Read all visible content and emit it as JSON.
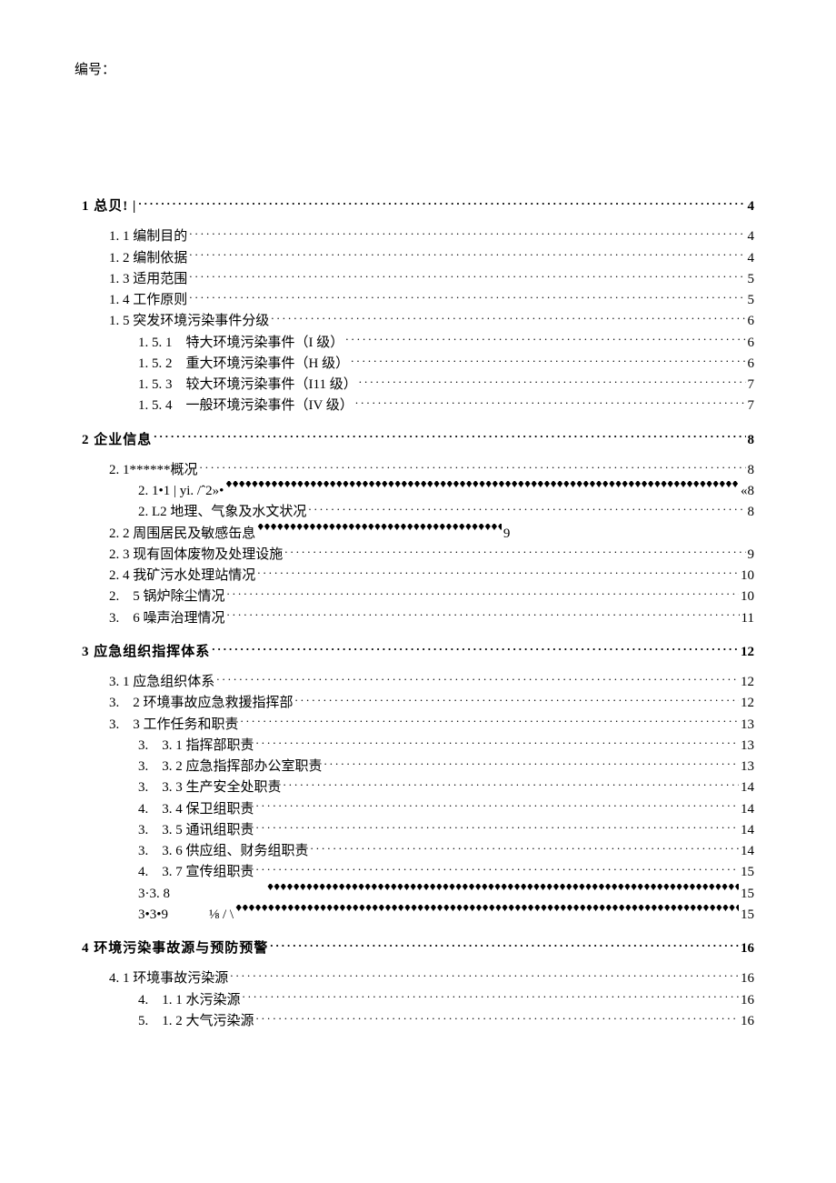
{
  "header": {
    "label": "编号："
  },
  "toc": [
    {
      "heading": {
        "text": "1 总贝! |",
        "page": "4"
      },
      "items": [
        {
          "indent": 1,
          "text": "1. 1 编制目的",
          "page": "4",
          "leader": "dot"
        },
        {
          "indent": 1,
          "text": "1. 2 编制依据",
          "page": "4",
          "leader": "dot"
        },
        {
          "indent": 1,
          "text": "1. 3 适用范围",
          "page": "5",
          "leader": "dot"
        },
        {
          "indent": 1,
          "text": "1. 4 工作原则",
          "page": "5",
          "leader": "dot"
        },
        {
          "indent": 1,
          "text": "1. 5 突发环境污染事件分级",
          "page": "6",
          "leader": "dot"
        },
        {
          "indent": 2,
          "text": "1. 5. 1　特大环境污染事件（I 级）",
          "page": "6",
          "leader": "dot"
        },
        {
          "indent": 2,
          "text": "1. 5. 2　重大环境污染事件（H 级）",
          "page": "6",
          "leader": "dot"
        },
        {
          "indent": 2,
          "text": "1. 5. 3　较大环境污染事件（I11 级）",
          "page": "7",
          "leader": "dot"
        },
        {
          "indent": 2,
          "text": "1. 5. 4　一般环境污染事件（IV 级）",
          "page": "7",
          "leader": "dot"
        }
      ]
    },
    {
      "heading": {
        "text": "2 企业信息",
        "page": "8"
      },
      "items": [
        {
          "indent": 1,
          "text": "2. 1******概况",
          "page": "8",
          "leader": "dot"
        },
        {
          "indent": 2,
          "text": "2. 1•1 | yi. /ˆ2»•",
          "page": "«8",
          "leader": "diamond"
        },
        {
          "indent": 2,
          "text": "2. L2 地理、气象及水文状况",
          "page": "8",
          "leader": "dot"
        },
        {
          "indent": 1,
          "text": "2. 2 周围居民及敏感缶息",
          "page": "9",
          "leader": "diamond",
          "short": true
        },
        {
          "indent": 1,
          "text": "2. 3 现有固体废物及处理设施",
          "page": "9",
          "leader": "dot"
        },
        {
          "indent": 1,
          "text": "2. 4 我矿污水处理站情况",
          "page": "10",
          "leader": "dot"
        },
        {
          "indent": 1,
          "text": "2.　5 锅炉除尘情况",
          "page": "10",
          "leader": "dot"
        },
        {
          "indent": 1,
          "text": "3.　6 噪声治理情况",
          "page": "11",
          "leader": "dot"
        }
      ]
    },
    {
      "heading": {
        "text": "3 应急组织指挥体系",
        "page": "12"
      },
      "items": [
        {
          "indent": 1,
          "text": "3. 1 应急组织体系",
          "page": "12",
          "leader": "dot"
        },
        {
          "indent": 1,
          "text": "3.　2 环境事故应急救援指挥部",
          "page": "12",
          "leader": "dot"
        },
        {
          "indent": 1,
          "text": "3.　3 工作任务和职责",
          "page": "13",
          "leader": "dot"
        },
        {
          "indent": 2,
          "text": "3.　3. 1 指挥部职责",
          "page": "13",
          "leader": "dot"
        },
        {
          "indent": 2,
          "text": "3.　3. 2 应急指挥部办公室职责",
          "page": "13",
          "leader": "dot"
        },
        {
          "indent": 2,
          "text": "3.　3. 3 生产安全处职责",
          "page": "14",
          "leader": "dot"
        },
        {
          "indent": 2,
          "text": "4.　3. 4 保卫组职责",
          "page": "14",
          "leader": "dot"
        },
        {
          "indent": 2,
          "text": "3.　3. 5 通讯组职责",
          "page": "14",
          "leader": "dot"
        },
        {
          "indent": 2,
          "text": "3.　3. 6 供应组、财务组职责",
          "page": "14",
          "leader": "dot"
        },
        {
          "indent": 2,
          "text": "4.　3. 7 宣传组职责",
          "page": "15",
          "leader": "dot"
        },
        {
          "indent": 2,
          "text": "3·3. 8　　　　　　　",
          "page": "15",
          "leader": "diamond"
        },
        {
          "indent": 2,
          "text": "3•3•9　　　⅛ / \\",
          "page": "15",
          "leader": "diamond"
        }
      ]
    },
    {
      "heading": {
        "text": "4 环境污染事故源与预防预警",
        "page": "16"
      },
      "items": [
        {
          "indent": 1,
          "text": "4. 1 环境事故污染源",
          "page": "16",
          "leader": "dot"
        },
        {
          "indent": 2,
          "text": "4.　1. 1 水污染源",
          "page": "16",
          "leader": "dot"
        },
        {
          "indent": 2,
          "text": "5.　1. 2 大气污染源",
          "page": "16",
          "leader": "dot"
        }
      ]
    }
  ]
}
